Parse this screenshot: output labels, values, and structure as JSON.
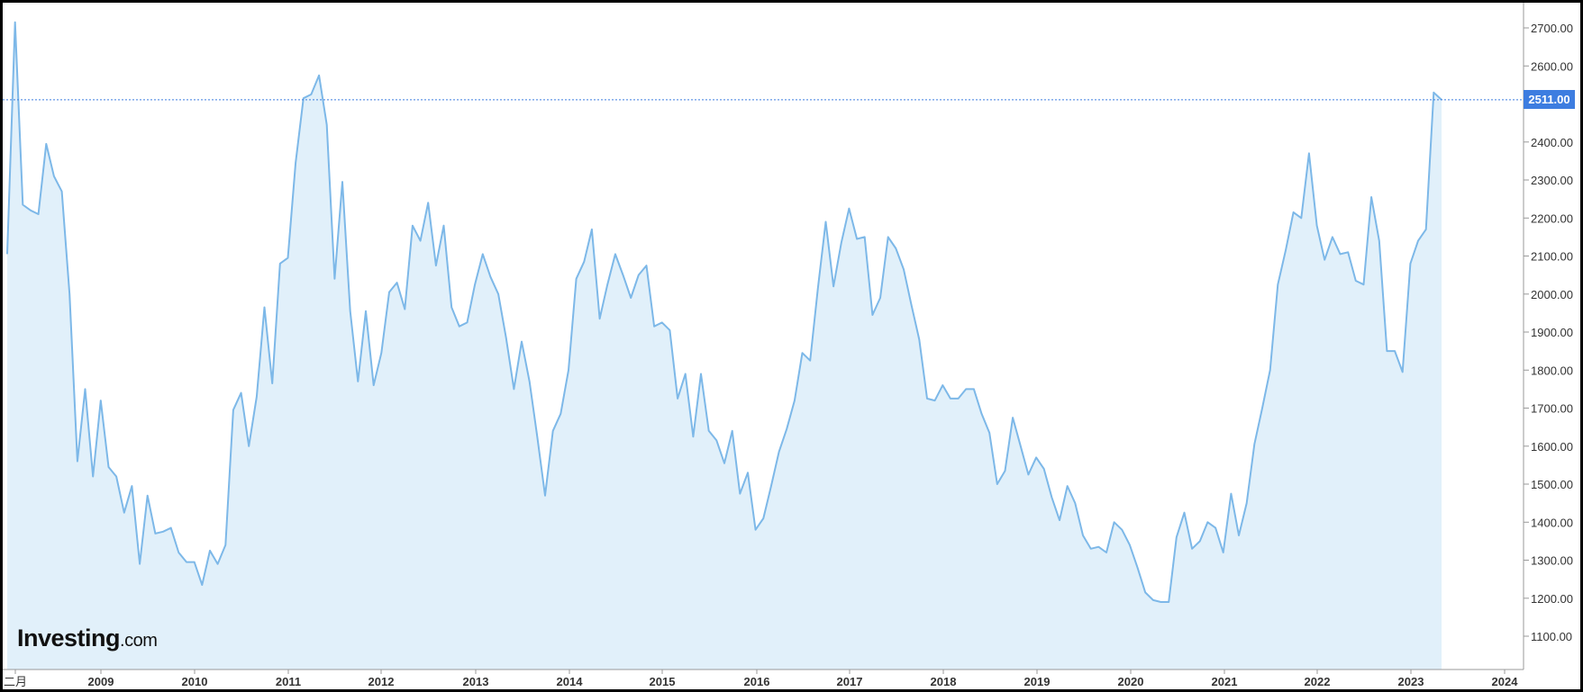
{
  "chart_data": {
    "type": "area",
    "title": "",
    "xlabel": "",
    "ylabel": "",
    "ylim": [
      1010,
      2740
    ],
    "y_ticks": [
      "1100.00",
      "1200.00",
      "1300.00",
      "1400.00",
      "1500.00",
      "1600.00",
      "1700.00",
      "1800.00",
      "1900.00",
      "2000.00",
      "2100.00",
      "2200.00",
      "2300.00",
      "2400.00",
      "2500.00",
      "2600.00",
      "2700.00"
    ],
    "x_tick_labels": [
      "二月",
      "2009",
      "2010",
      "2011",
      "2012",
      "2013",
      "2014",
      "2015",
      "2016",
      "2017",
      "2018",
      "2019",
      "2020",
      "2021",
      "2022",
      "2023",
      "2024"
    ],
    "last_value_label": "2511.00",
    "last_value": 2511,
    "grid": false,
    "line_color": "#7db8e8",
    "fill_color": "#e1f0fa",
    "reference_line_color": "#3d7de0",
    "values": [
      2105,
      2715,
      2235,
      2220,
      2210,
      2395,
      2310,
      2270,
      2000,
      1560,
      1750,
      1520,
      1720,
      1545,
      1520,
      1425,
      1495,
      1290,
      1470,
      1370,
      1375,
      1385,
      1320,
      1295,
      1295,
      1235,
      1325,
      1290,
      1340,
      1695,
      1740,
      1600,
      1730,
      1965,
      1765,
      2080,
      2095,
      2345,
      2515,
      2525,
      2575,
      2445,
      2040,
      2295,
      1955,
      1770,
      1955,
      1760,
      1845,
      2005,
      2030,
      1960,
      2180,
      2140,
      2240,
      2075,
      2180,
      1965,
      1915,
      1925,
      2025,
      2105,
      2045,
      2000,
      1885,
      1750,
      1875,
      1770,
      1625,
      1470,
      1640,
      1685,
      1800,
      2040,
      2085,
      2170,
      1935,
      2025,
      2105,
      2050,
      1990,
      2050,
      2075,
      1915,
      1925,
      1905,
      1725,
      1790,
      1625,
      1790,
      1640,
      1615,
      1555,
      1640,
      1475,
      1530,
      1380,
      1410,
      1495,
      1585,
      1645,
      1720,
      1845,
      1825,
      2015,
      2190,
      2020,
      2135,
      2225,
      2145,
      2150,
      1945,
      1990,
      2150,
      2120,
      2065,
      1970,
      1880,
      1725,
      1720,
      1760,
      1725,
      1725,
      1750,
      1750,
      1685,
      1635,
      1500,
      1535,
      1675,
      1600,
      1525,
      1570,
      1540,
      1465,
      1405,
      1495,
      1450,
      1365,
      1330,
      1335,
      1320,
      1400,
      1380,
      1340,
      1280,
      1215,
      1195,
      1190,
      1190,
      1360,
      1425,
      1330,
      1350,
      1400,
      1385,
      1320,
      1475,
      1365,
      1450,
      1605,
      1700,
      1800,
      2025,
      2115,
      2215,
      2200,
      2370,
      2180,
      2090,
      2150,
      2105,
      2110,
      2035,
      2025,
      2255,
      2140,
      1850,
      1850,
      1795,
      2080,
      2140,
      2170,
      2530,
      2511
    ]
  },
  "logo": {
    "brand": "Investing",
    "suffix": ".com"
  }
}
